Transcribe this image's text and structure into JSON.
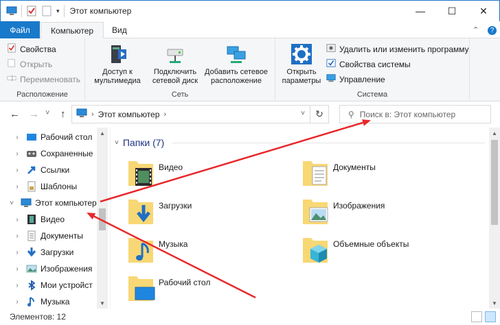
{
  "window": {
    "title": "Этот компьютер",
    "controls": {
      "minimize": "—",
      "maximize": "☐",
      "close": "✕"
    }
  },
  "quick_access": {
    "dropdown_glyph": "▾"
  },
  "ribbon_tabs": [
    {
      "label": "Файл"
    },
    {
      "label": "Компьютер"
    },
    {
      "label": "Вид"
    }
  ],
  "ribbon_controls": {
    "collapse_glyph": "⌃",
    "help_glyph": "?"
  },
  "ribbon": {
    "location": {
      "label": "Расположение",
      "properties": "Свойства",
      "open": "Открыть",
      "rename": "Переименовать"
    },
    "network": {
      "label": "Сеть",
      "media_access": [
        "Доступ к",
        "мультимедиа"
      ],
      "map_drive": [
        "Подключить",
        "сетевой диск"
      ],
      "add_location": [
        "Добавить сетевое",
        "расположение"
      ]
    },
    "system": {
      "label": "Система",
      "open_settings": [
        "Открыть",
        "параметры"
      ],
      "uninstall": "Удалить или изменить программу",
      "system_properties": "Свойства системы",
      "manage": "Управление"
    }
  },
  "address": {
    "back_glyph": "←",
    "forward_glyph": "→",
    "recent_glyph": "˅",
    "up_glyph": "↑",
    "path": "Этот компьютер",
    "chevron_glyph": "›",
    "dropdown_glyph": "˅",
    "refresh_glyph": "↻",
    "search_placeholder": "Поиск в: Этот компьютер"
  },
  "nav_pane": {
    "expand_glyph": "›",
    "expanded_glyph": "˅",
    "items": [
      {
        "label": "Рабочий стол",
        "icon": "desktop-icon"
      },
      {
        "label": "Сохраненные",
        "icon": "saved-games-icon"
      },
      {
        "label": "Ссылки",
        "icon": "links-icon"
      },
      {
        "label": "Шаблоны",
        "icon": "templates-icon"
      },
      {
        "label": "Этот компьютер",
        "icon": "computer-icon"
      },
      {
        "label": "Видео",
        "icon": "video-icon"
      },
      {
        "label": "Документы",
        "icon": "documents-icon"
      },
      {
        "label": "Загрузки",
        "icon": "downloads-icon"
      },
      {
        "label": "Изображения",
        "icon": "pictures-icon"
      },
      {
        "label": "Мои устройст",
        "icon": "bluetooth-icon"
      },
      {
        "label": "Музыка",
        "icon": "music-icon"
      }
    ]
  },
  "content": {
    "section_title": "Папки (7)",
    "section_caret": "˅",
    "folders": [
      {
        "name": "Видео",
        "icon": "video-folder-icon"
      },
      {
        "name": "Документы",
        "icon": "documents-folder-icon"
      },
      {
        "name": "Загрузки",
        "icon": "downloads-folder-icon"
      },
      {
        "name": "Изображения",
        "icon": "pictures-folder-icon"
      },
      {
        "name": "Музыка",
        "icon": "music-folder-icon"
      },
      {
        "name": "Объемные объекты",
        "icon": "3d-objects-folder-icon"
      },
      {
        "name": "Рабочий стол",
        "icon": "desktop-folder-icon"
      }
    ]
  },
  "scroll": {
    "up_glyph": "▲",
    "down_glyph": "▼"
  },
  "status": {
    "items_count": "Элементов: 12"
  },
  "colors": {
    "accent": "#1979ca",
    "selection": "#cce8ff",
    "folder": "#f8d775",
    "arrow": "#e8282b"
  }
}
